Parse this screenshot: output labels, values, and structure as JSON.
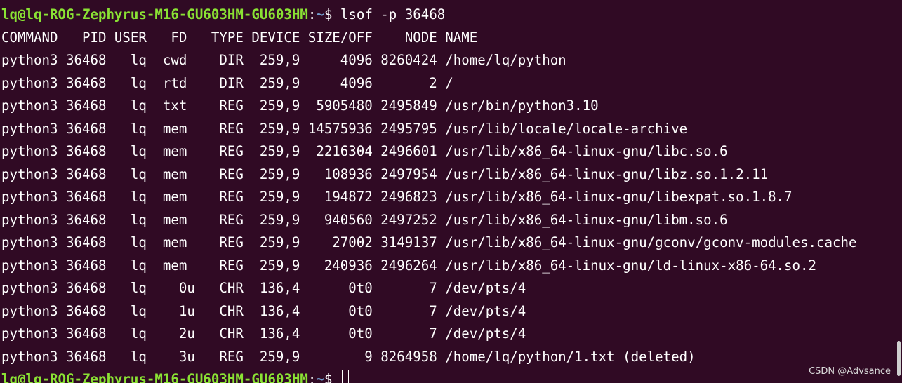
{
  "prompt": {
    "user_host": "lq@lq-ROG-Zephyrus-M16-GU603HM-GU603HM",
    "colon": ":",
    "path": "~",
    "dollar": "$ ",
    "command": "lsof -p 36468"
  },
  "output": {
    "header": "COMMAND   PID USER   FD   TYPE DEVICE SIZE/OFF    NODE NAME",
    "rows": [
      "python3 36468   lq  cwd    DIR  259,9     4096 8260424 /home/lq/python",
      "python3 36468   lq  rtd    DIR  259,9     4096       2 /",
      "python3 36468   lq  txt    REG  259,9  5905480 2495849 /usr/bin/python3.10",
      "python3 36468   lq  mem    REG  259,9 14575936 2495795 /usr/lib/locale/locale-archive",
      "python3 36468   lq  mem    REG  259,9  2216304 2496601 /usr/lib/x86_64-linux-gnu/libc.so.6",
      "python3 36468   lq  mem    REG  259,9   108936 2497954 /usr/lib/x86_64-linux-gnu/libz.so.1.2.11",
      "python3 36468   lq  mem    REG  259,9   194872 2496823 /usr/lib/x86_64-linux-gnu/libexpat.so.1.8.7",
      "python3 36468   lq  mem    REG  259,9   940560 2497252 /usr/lib/x86_64-linux-gnu/libm.so.6",
      "python3 36468   lq  mem    REG  259,9    27002 3149137 /usr/lib/x86_64-linux-gnu/gconv/gconv-modules.cache",
      "python3 36468   lq  mem    REG  259,9   240936 2496264 /usr/lib/x86_64-linux-gnu/ld-linux-x86-64.so.2",
      "python3 36468   lq    0u   CHR  136,4      0t0       7 /dev/pts/4",
      "python3 36468   lq    1u   CHR  136,4      0t0       7 /dev/pts/4",
      "python3 36468   lq    2u   CHR  136,4      0t0       7 /dev/pts/4",
      "python3 36468   lq    3u   REG  259,9        9 8264958 /home/lq/python/1.txt (deleted)"
    ]
  },
  "watermark": "CSDN @Advsance",
  "colors": {
    "background": "#300a24",
    "prompt_user": "#8ae234",
    "prompt_path": "#729fcf",
    "text": "#ffffff"
  }
}
